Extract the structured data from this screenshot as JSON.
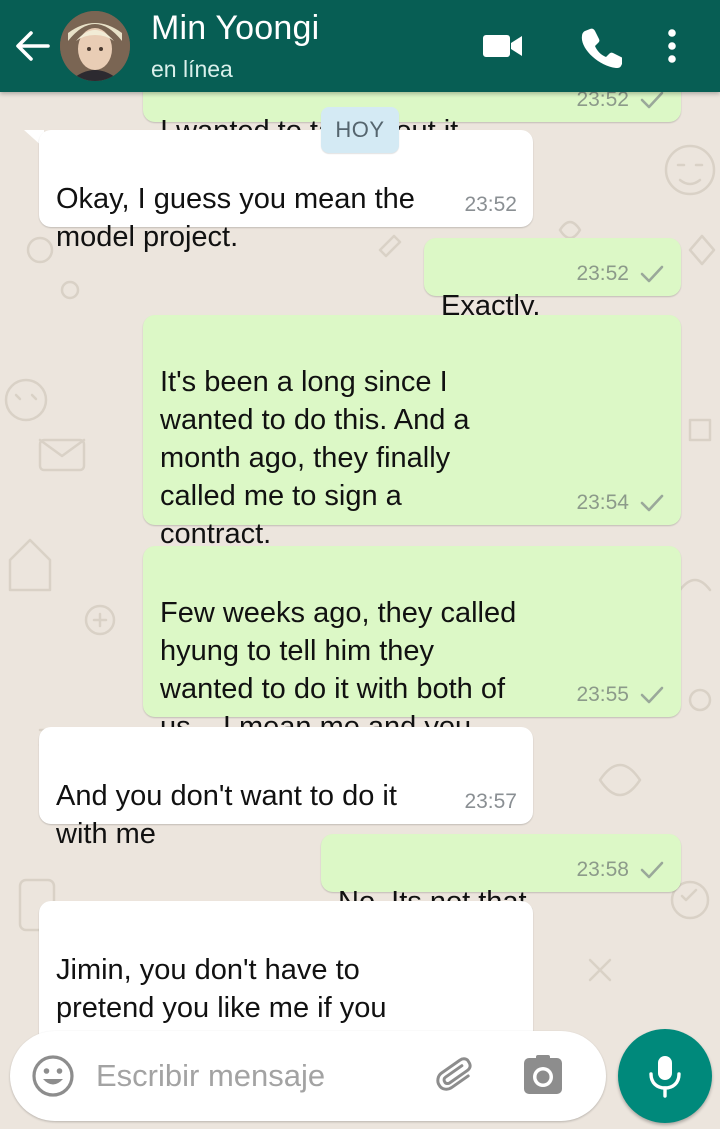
{
  "header": {
    "contact_name": "Min Yoongi",
    "status": "en línea",
    "icons": [
      "back-arrow-icon",
      "video-call-icon",
      "phone-icon",
      "more-options-icon"
    ],
    "color": "#075e54"
  },
  "date_chip": "HOY",
  "messages": [
    {
      "direction": "out",
      "text": "I wanted to talk about it.",
      "time": "23:52",
      "status": "sent"
    },
    {
      "direction": "in",
      "text": "Okay, I guess you mean the\nmodel project.",
      "time": "23:52"
    },
    {
      "direction": "out",
      "text": "Exactly.",
      "time": "23:52",
      "status": "sent"
    },
    {
      "direction": "out",
      "text": "It's been a long since I\nwanted to do this. And a\nmonth ago, they finally\ncalled me to sign a\ncontract.",
      "time": "23:54",
      "status": "sent"
    },
    {
      "direction": "out",
      "text": "Few weeks ago, they called\nhyung to tell him they\nwanted to do it with both of\nus... I mean me and you.",
      "time": "23:55",
      "status": "sent"
    },
    {
      "direction": "in",
      "text": "And you don't want to do it\nwith me",
      "time": "23:57"
    },
    {
      "direction": "out",
      "text": "No. Its not that.",
      "time": "23:58",
      "status": "sent"
    },
    {
      "direction": "in",
      "text": "Jimin, you don't have to\npretend you like me if you\ndon't. Seriously, I'm trying to",
      "time": ""
    }
  ],
  "composer": {
    "placeholder": "Escribir mensaje",
    "icons": [
      "emoji-icon",
      "attach-icon",
      "camera-icon",
      "mic-icon"
    ]
  },
  "colors": {
    "outgoing_bubble": "#dcf8c6",
    "incoming_bubble": "#ffffff",
    "chat_background": "#ece5dd",
    "date_chip": "#d4eaf4",
    "mic_button": "#00897b"
  }
}
